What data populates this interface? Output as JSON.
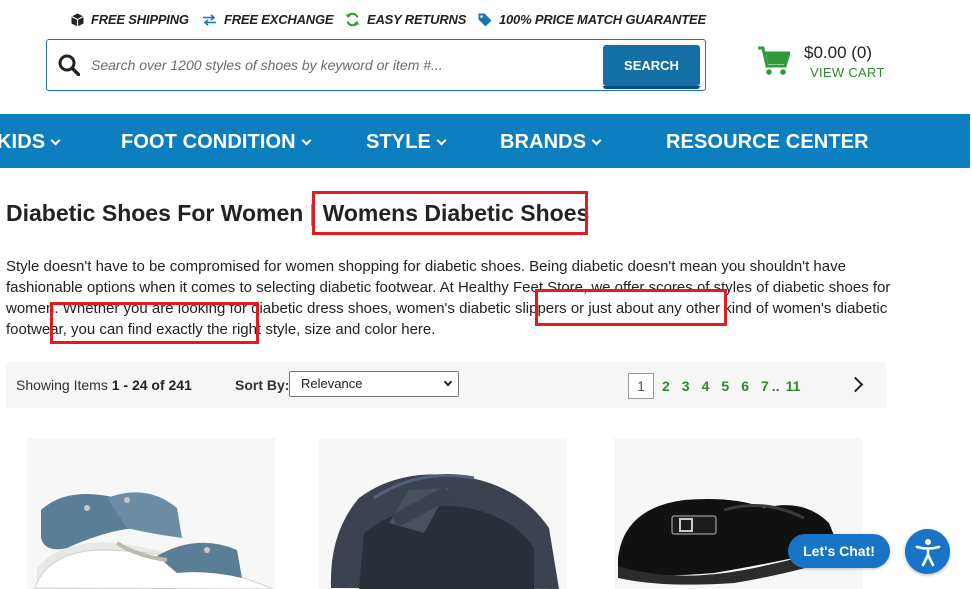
{
  "perks": [
    {
      "label": "FREE SHIPPING",
      "icon": "box-icon"
    },
    {
      "label": "FREE EXCHANGE",
      "icon": "exchange-arrows-icon"
    },
    {
      "label": "EASY RETURNS",
      "icon": "refresh-icon"
    },
    {
      "label": "100% PRICE MATCH GUARANTEE",
      "icon": "price-tag-icon"
    }
  ],
  "search": {
    "placeholder": "Search over 1200 styles of shoes by keyword or item #...",
    "button_label": "SEARCH"
  },
  "cart": {
    "total": "$0.00 (0)",
    "link_label": "VIEW CART"
  },
  "nav": {
    "items": [
      {
        "label": "KIDS",
        "has_dropdown": true
      },
      {
        "label": "FOOT CONDITION",
        "has_dropdown": true
      },
      {
        "label": "STYLE",
        "has_dropdown": true
      },
      {
        "label": "BRANDS",
        "has_dropdown": true
      },
      {
        "label": "RESOURCE CENTER",
        "has_dropdown": false
      }
    ]
  },
  "page": {
    "title_main": "Diabetic Shoes For Women |",
    "title_highlight": "Womens Diabetic Shoes",
    "intro_part1": "Style doesn't have to be compromised for women shopping for diabetic shoes. Being diabetic doesn't mean you shouldn't have fashionable options when it comes to selecting diabetic footwear. At Healthy Feet Store, we offer scores of styles of diabetic shoes for women. Whether you are looking for diabetic dress shoes, ",
    "intro_link1": "women's diabetic slippers",
    "intro_part2": " or just about any other kind of ",
    "intro_link2": "women's diabetic footwear",
    "intro_part3": ", you can find exactly the right style, size and color here."
  },
  "toolbar": {
    "showing_prefix": "Showing Items ",
    "showing_range": "1 - 24 of 241",
    "sort_label": "Sort By:",
    "sort_value": "Relevance",
    "pages": [
      "1",
      "2",
      "3",
      "4",
      "5",
      "6",
      "7",
      "..",
      "11"
    ],
    "current_page": "1"
  },
  "chat": {
    "label": "Let's Chat!"
  },
  "colors": {
    "brand_blue": "#0d7ec0",
    "button_blue": "#146fa6",
    "accent_green": "#2e8a2e",
    "highlight_red": "#e11b22"
  }
}
